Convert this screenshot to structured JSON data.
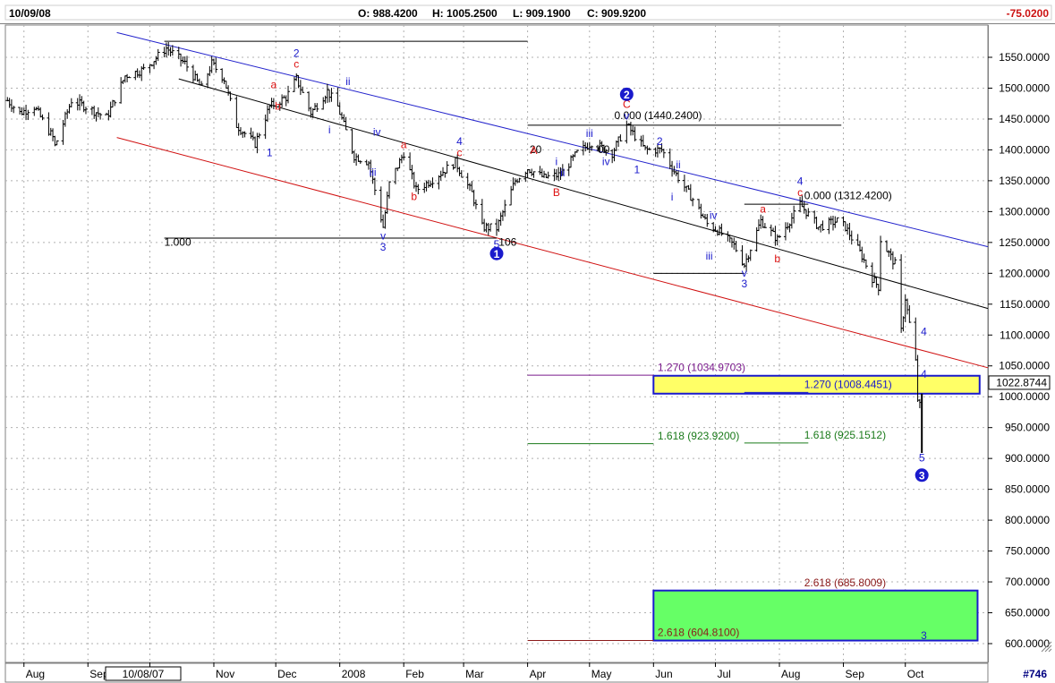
{
  "header": {
    "date": "10/09/08",
    "open": "O: 988.4200",
    "high": "H: 1005.2500",
    "low": "L: 909.1900",
    "close": "C: 909.9200",
    "change": "-75.0200"
  },
  "footer": {
    "cursor_date": "10/08/07",
    "chart_number": "#746"
  },
  "colors": {
    "channel_upper": "#2222cc",
    "channel_middle": "#000000",
    "channel_lower": "#d01010",
    "wave_blue": "#1a1acc",
    "wave_red": "#dd1111",
    "target_yellow": "#ffff66",
    "target_green": "#66ff66",
    "fib_purple": "#7a1a8c",
    "fib_green": "#1a7a1a",
    "fib_darkred": "#8b1a1a"
  },
  "chart_data": {
    "type": "ohlc",
    "title": "",
    "xlabel": "",
    "ylabel": "",
    "ylim": [
      590,
      1600
    ],
    "y_ticks": [
      "1550.0000",
      "1500.0000",
      "1450.0000",
      "1400.0000",
      "1350.0000",
      "1300.0000",
      "1250.0000",
      "1200.0000",
      "1150.0000",
      "1100.0000",
      "1050.0000",
      "1000.0000",
      "950.0000",
      "900.0000",
      "850.0000",
      "800.0000",
      "750.0000",
      "700.0000",
      "650.0000",
      "600.0000"
    ],
    "y_tick_values": [
      1550,
      1500,
      1450,
      1400,
      1350,
      1300,
      1250,
      1200,
      1150,
      1100,
      1050,
      1000,
      950,
      900,
      850,
      800,
      750,
      700,
      650,
      600
    ],
    "x_labels": [
      "Aug",
      "Sep",
      "Oct",
      "Nov",
      "Dec",
      "2008",
      "Feb",
      "Mar",
      "Apr",
      "May",
      "Jun",
      "Jul",
      "Aug",
      "Sep",
      "Oct"
    ],
    "x_label_positions": [
      "2007-08-01",
      "2007-09-01",
      "2007-10-01",
      "2007-11-01",
      "2007-12-01",
      "2008-01-01",
      "2008-02-01",
      "2008-03-01",
      "2008-04-01",
      "2008-05-01",
      "2008-06-01",
      "2008-07-01",
      "2008-08-01",
      "2008-09-01",
      "2008-10-01"
    ],
    "x_range": [
      "2007-07-23",
      "2008-11-10"
    ],
    "current_price": "1022.8744",
    "price_path": [
      [
        "2007-07-24",
        1480
      ],
      [
        "2007-07-30",
        1460
      ],
      [
        "2007-08-06",
        1470
      ],
      [
        "2007-08-15",
        1420
      ],
      [
        "2007-08-16",
        1406
      ],
      [
        "2007-08-24",
        1480
      ],
      [
        "2007-08-31",
        1470
      ],
      [
        "2007-09-10",
        1452
      ],
      [
        "2007-09-19",
        1520
      ],
      [
        "2007-09-28",
        1530
      ],
      [
        "2007-10-09",
        1565
      ],
      [
        "2007-10-18",
        1540
      ],
      [
        "2007-10-26",
        1500
      ],
      [
        "2007-10-31",
        1540
      ],
      [
        "2007-11-06",
        1515
      ],
      [
        "2007-11-12",
        1440
      ],
      [
        "2007-11-21",
        1410
      ],
      [
        "2007-11-28",
        1470
      ],
      [
        "2007-12-06",
        1485
      ],
      [
        "2007-12-11",
        1515
      ],
      [
        "2007-12-18",
        1460
      ],
      [
        "2007-12-26",
        1495
      ],
      [
        "2007-12-31",
        1470
      ],
      [
        "2008-01-08",
        1390
      ],
      [
        "2008-01-15",
        1380
      ],
      [
        "2008-01-22",
        1275
      ],
      [
        "2008-01-25",
        1345
      ],
      [
        "2008-02-01",
        1395
      ],
      [
        "2008-02-07",
        1335
      ],
      [
        "2008-02-14",
        1350
      ],
      [
        "2008-02-26",
        1380
      ],
      [
        "2008-03-05",
        1330
      ],
      [
        "2008-03-10",
        1275
      ],
      [
        "2008-03-17",
        1273
      ],
      [
        "2008-03-26",
        1350
      ],
      [
        "2008-04-01",
        1370
      ],
      [
        "2008-04-09",
        1355
      ],
      [
        "2008-04-17",
        1360
      ],
      [
        "2008-04-25",
        1395
      ],
      [
        "2008-05-02",
        1412
      ],
      [
        "2008-05-12",
        1395
      ],
      [
        "2008-05-19",
        1440
      ],
      [
        "2008-05-28",
        1400
      ],
      [
        "2008-06-05",
        1400
      ],
      [
        "2008-06-12",
        1360
      ],
      [
        "2008-06-20",
        1320
      ],
      [
        "2008-06-27",
        1280
      ],
      [
        "2008-07-02",
        1270
      ],
      [
        "2008-07-10",
        1245
      ],
      [
        "2008-07-15",
        1214
      ],
      [
        "2008-07-23",
        1285
      ],
      [
        "2008-07-31",
        1255
      ],
      [
        "2008-08-08",
        1295
      ],
      [
        "2008-08-11",
        1312
      ],
      [
        "2008-08-20",
        1275
      ],
      [
        "2008-08-29",
        1285
      ],
      [
        "2008-09-02",
        1275
      ],
      [
        "2008-09-10",
        1228
      ],
      [
        "2008-09-15",
        1192
      ],
      [
        "2008-09-18",
        1178
      ],
      [
        "2008-09-19",
        1255
      ],
      [
        "2008-09-26",
        1215
      ],
      [
        "2008-09-29",
        1106
      ],
      [
        "2008-10-01",
        1160
      ],
      [
        "2008-10-06",
        1056
      ],
      [
        "2008-10-07",
        996
      ],
      [
        "2008-10-08",
        985
      ],
      [
        "2008-10-09",
        910
      ]
    ],
    "channels": [
      {
        "name": "upper",
        "color": "#2222cc",
        "from": [
          "2007-09-15",
          1590
        ],
        "to": [
          "2008-11-10",
          1243
        ]
      },
      {
        "name": "middle",
        "color": "#000000",
        "from": [
          "2007-10-15",
          1515
        ],
        "to": [
          "2008-11-10",
          1143
        ]
      },
      {
        "name": "lower",
        "color": "#d01010",
        "from": [
          "2007-09-15",
          1420
        ],
        "to": [
          "2008-11-10",
          1047
        ]
      }
    ],
    "h_lines": [
      {
        "from": [
          "2007-10-08",
          1576
        ],
        "to": [
          "2008-04-01",
          1576
        ],
        "color": "#000000"
      },
      {
        "from": [
          "2007-10-08",
          1257
        ],
        "to": [
          "2008-03-17",
          1257
        ],
        "color": "#000000"
      },
      {
        "from": [
          "2008-04-01",
          1440
        ],
        "to": [
          "2008-08-31",
          1440
        ],
        "color": "#000000"
      },
      {
        "from": [
          "2008-06-01",
          1200
        ],
        "to": [
          "2008-07-15",
          1200
        ],
        "color": "#000000"
      },
      {
        "from": [
          "2008-07-15",
          1312
        ],
        "to": [
          "2008-08-15",
          1312
        ],
        "color": "#000000"
      },
      {
        "from": [
          "2008-04-01",
          1035
        ],
        "to": [
          "2008-06-01",
          1035
        ],
        "color": "#7a1a8c"
      },
      {
        "from": [
          "2008-04-01",
          924
        ],
        "to": [
          "2008-06-01",
          924
        ],
        "color": "#1a7a1a"
      },
      {
        "from": [
          "2008-07-15",
          925
        ],
        "to": [
          "2008-08-15",
          925
        ],
        "color": "#1a7a1a"
      },
      {
        "from": [
          "2008-07-15",
          1007
        ],
        "to": [
          "2008-08-15",
          1007
        ],
        "color": "#1a1acc"
      },
      {
        "from": [
          "2008-04-01",
          605
        ],
        "to": [
          "2008-06-01",
          605
        ],
        "color": "#8b1a1a"
      }
    ],
    "zones": [
      {
        "name": "yellow-target",
        "color": "#ffff66",
        "border": "#1a1acc",
        "from": [
          "2008-06-01",
          1034
        ],
        "to": [
          "2008-11-06",
          1005
        ]
      },
      {
        "name": "green-target",
        "color": "#66ff66",
        "border": "#1a1acc",
        "from": [
          "2008-06-01",
          686
        ],
        "to": [
          "2008-11-05",
          605
        ]
      }
    ],
    "annotations": [
      {
        "text": "1.000",
        "x": "2007-10-08",
        "y": 1245,
        "color": "#000000"
      },
      {
        "text": "106",
        "x": "2008-03-18",
        "y": 1245,
        "color": "#000000"
      },
      {
        "text": "0.000 (1440.2400)",
        "x": "2008-05-13",
        "y": 1450,
        "color": "#000000"
      },
      {
        "text": "20",
        "x": "2008-04-02",
        "y": 1395,
        "color": "#000000"
      },
      {
        "text": "00",
        "x": "2008-05-05",
        "y": 1395,
        "color": "#000000"
      },
      {
        "text": "0.000 (1312.4200)",
        "x": "2008-08-13",
        "y": 1320,
        "color": "#000000"
      },
      {
        "text": "1.270 (1034.9703)",
        "x": "2008-06-03",
        "y": 1042,
        "color": "#7a1a8c"
      },
      {
        "text": "1.270 (1008.4451)",
        "x": "2008-08-13",
        "y": 1014,
        "color": "#1a1acc"
      },
      {
        "text": "1.618 (923.9200)",
        "x": "2008-06-03",
        "y": 931,
        "color": "#1a7a1a"
      },
      {
        "text": "1.618 (925.1512)",
        "x": "2008-08-13",
        "y": 932,
        "color": "#1a7a1a"
      },
      {
        "text": "2.618 (685.8009)",
        "x": "2008-08-13",
        "y": 693,
        "color": "#8b1a1a"
      },
      {
        "text": "2.618 (604.8100)",
        "x": "2008-06-03",
        "y": 612,
        "color": "#8b1a1a"
      }
    ],
    "wave_labels": [
      {
        "text": "1",
        "x": "2007-11-28",
        "y": 1390,
        "color": "#1a1acc"
      },
      {
        "text": "a",
        "x": "2007-11-30",
        "y": 1500,
        "color": "#dd1111"
      },
      {
        "text": "b",
        "x": "2007-12-02",
        "y": 1465,
        "color": "#dd1111"
      },
      {
        "text": "2",
        "x": "2007-12-11",
        "y": 1551,
        "color": "#1a1acc"
      },
      {
        "text": "c",
        "x": "2007-12-11",
        "y": 1533,
        "color": "#dd1111"
      },
      {
        "text": "i",
        "x": "2007-12-27",
        "y": 1427,
        "color": "#1a1acc"
      },
      {
        "text": "ii",
        "x": "2008-01-05",
        "y": 1505,
        "color": "#1a1acc"
      },
      {
        "text": "iv",
        "x": "2008-01-19",
        "y": 1423,
        "color": "#1a1acc"
      },
      {
        "text": "iii",
        "x": "2008-01-17",
        "y": 1358,
        "color": "#1a1acc"
      },
      {
        "text": "a",
        "x": "2008-02-01",
        "y": 1403,
        "color": "#dd1111"
      },
      {
        "text": "b",
        "x": "2008-02-06",
        "y": 1319,
        "color": "#dd1111"
      },
      {
        "text": "v",
        "x": "2008-01-22",
        "y": 1255,
        "color": "#1a1acc"
      },
      {
        "text": "3",
        "x": "2008-01-22",
        "y": 1237,
        "color": "#1a1acc"
      },
      {
        "text": "4",
        "x": "2008-02-28",
        "y": 1408,
        "color": "#1a1acc"
      },
      {
        "text": "c",
        "x": "2008-02-28",
        "y": 1390,
        "color": "#dd1111"
      },
      {
        "text": "5",
        "x": "2008-03-17",
        "y": 1241,
        "color": "#1a1acc"
      },
      {
        "text": "A",
        "x": "2008-04-04",
        "y": 1393,
        "color": "#dd1111"
      },
      {
        "text": "B",
        "x": "2008-04-15",
        "y": 1325,
        "color": "#dd1111"
      },
      {
        "text": "ii",
        "x": "2008-04-18",
        "y": 1357,
        "color": "#1a1acc"
      },
      {
        "text": "i",
        "x": "2008-04-15",
        "y": 1375,
        "color": "#1a1acc"
      },
      {
        "text": "iii",
        "x": "2008-05-01",
        "y": 1421,
        "color": "#1a1acc"
      },
      {
        "text": "iv",
        "x": "2008-05-09",
        "y": 1375,
        "color": "#1a1acc"
      },
      {
        "text": "1",
        "x": "2008-05-24",
        "y": 1362,
        "color": "#1a1acc"
      },
      {
        "text": "C",
        "x": "2008-05-19",
        "y": 1468,
        "color": "#dd1111"
      },
      {
        "text": "v",
        "x": "2008-05-19",
        "y": 1449,
        "color": "#1a1acc"
      },
      {
        "text": "2",
        "x": "2008-06-04",
        "y": 1408,
        "color": "#1a1acc"
      },
      {
        "text": "ii",
        "x": "2008-06-13",
        "y": 1370,
        "color": "#1a1acc"
      },
      {
        "text": "i",
        "x": "2008-06-10",
        "y": 1318,
        "color": "#1a1acc"
      },
      {
        "text": "iv",
        "x": "2008-06-30",
        "y": 1288,
        "color": "#1a1acc"
      },
      {
        "text": "iii",
        "x": "2008-06-28",
        "y": 1222,
        "color": "#1a1acc"
      },
      {
        "text": "v",
        "x": "2008-07-15",
        "y": 1195,
        "color": "#1a1acc"
      },
      {
        "text": "3",
        "x": "2008-07-15",
        "y": 1177,
        "color": "#1a1acc"
      },
      {
        "text": "a",
        "x": "2008-07-24",
        "y": 1298,
        "color": "#dd1111"
      },
      {
        "text": "b",
        "x": "2008-07-31",
        "y": 1218,
        "color": "#dd1111"
      },
      {
        "text": "4",
        "x": "2008-08-11",
        "y": 1343,
        "color": "#1a1acc"
      },
      {
        "text": "c",
        "x": "2008-08-11",
        "y": 1325,
        "color": "#dd1111"
      },
      {
        "text": "4",
        "x": "2008-10-10",
        "y": 1100,
        "color": "#1a1acc"
      },
      {
        "text": "4",
        "x": "2008-10-10",
        "y": 1031,
        "color": "#1a1acc"
      },
      {
        "text": "5",
        "x": "2008-10-09",
        "y": 895,
        "color": "#1a1acc"
      },
      {
        "text": "3",
        "x": "2008-10-10",
        "y": 607,
        "color": "#1a1acc"
      }
    ],
    "circled_labels": [
      {
        "text": "1",
        "x": "2008-03-17",
        "y": 1232
      },
      {
        "text": "2",
        "x": "2008-05-19",
        "y": 1490
      },
      {
        "text": "3",
        "x": "2008-10-09",
        "y": 873
      }
    ]
  }
}
